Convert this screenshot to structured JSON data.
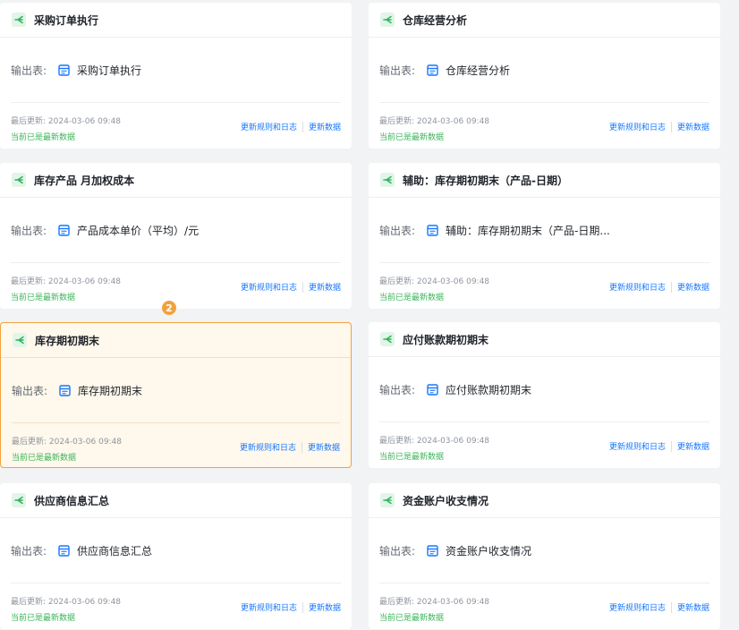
{
  "common": {
    "output_label": "输出表:",
    "updated_prefix": "最后更新:",
    "updated_time": "2024-03-06 09:48",
    "status": "当前已是最新数据",
    "rules_link": "更新规则和日志",
    "data_link": "更新数据"
  },
  "step_badge": "2",
  "colors": {
    "accent": "#1677ff",
    "status_green": "#3bb55a",
    "highlight_border": "#f2a23c",
    "highlight_bg": "#fff8ec"
  },
  "cards": [
    {
      "title": "采购订单执行",
      "output": "采购订单执行",
      "highlighted": false
    },
    {
      "title": "仓库经营分析",
      "output": "仓库经营分析",
      "highlighted": false
    },
    {
      "title": "库存产品 月加权成本",
      "output": "产品成本单价（平均）/元",
      "highlighted": false
    },
    {
      "title": "辅助：库存期初期末（产品-日期）",
      "output": "辅助：库存期初期末（产品-日期...",
      "highlighted": false
    },
    {
      "title": "库存期初期末",
      "output": "库存期初期末",
      "highlighted": true
    },
    {
      "title": "应付账款期初期末",
      "output": "应付账款期初期末",
      "highlighted": false
    },
    {
      "title": "供应商信息汇总",
      "output": "供应商信息汇总",
      "highlighted": false
    },
    {
      "title": "资金账户收支情况",
      "output": "资金账户收支情况",
      "highlighted": false
    }
  ]
}
